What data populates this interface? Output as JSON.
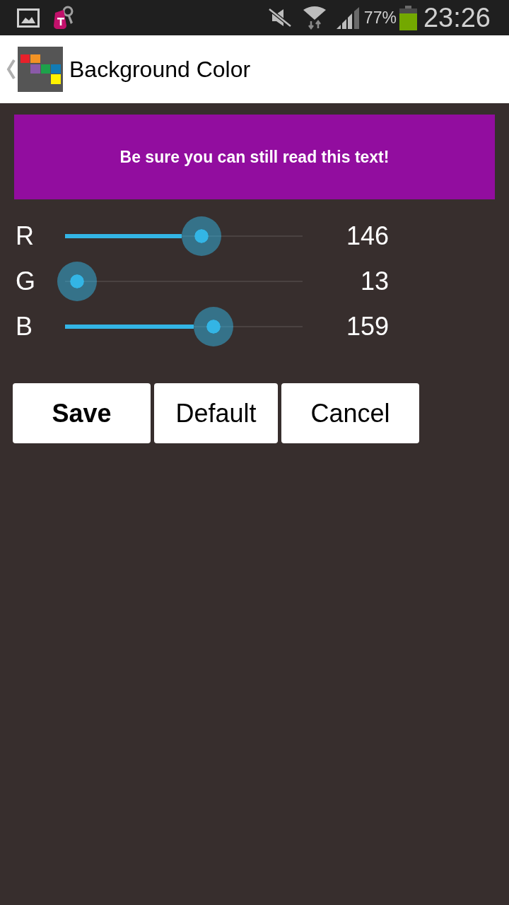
{
  "status_bar": {
    "battery": "77%",
    "time": "23:26"
  },
  "app_bar": {
    "title": "Background Color"
  },
  "preview": {
    "text": "Be sure you can still read this text!"
  },
  "sliders": [
    {
      "label": "R",
      "level": 0.573,
      "reading": "146"
    },
    {
      "label": "G",
      "level": 0.051,
      "reading": "13"
    },
    {
      "label": "B",
      "level": 0.624,
      "reading": "159"
    }
  ],
  "buttons": [
    {
      "label": "Save",
      "kind": "primary"
    },
    {
      "label": "Default",
      "kind": "normal"
    },
    {
      "label": "Cancel",
      "kind": "normal"
    }
  ]
}
